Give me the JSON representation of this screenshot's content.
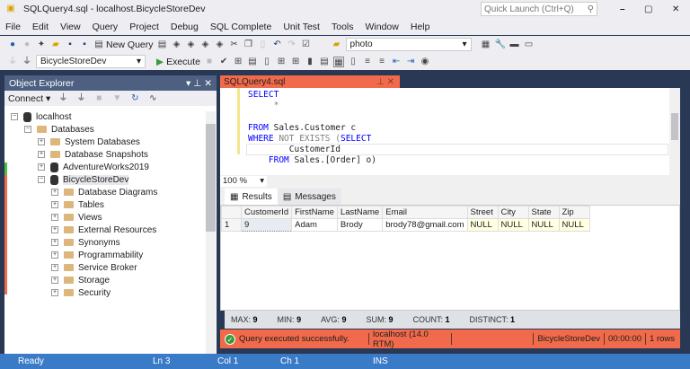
{
  "window": {
    "title": "SQLQuery4.sql - localhost.BicycleStoreDev",
    "quick_launch_placeholder": "Quick Launch (Ctrl+Q)"
  },
  "menu": [
    "File",
    "Edit",
    "View",
    "Query",
    "Project",
    "Debug",
    "SQL Complete",
    "Unit Test",
    "Tools",
    "Window",
    "Help"
  ],
  "toolbar": {
    "new_query": "New Query",
    "search_combo": "photo",
    "database": "BicycleStoreDev",
    "execute": "Execute"
  },
  "object_explorer": {
    "title": "Object Explorer",
    "connect": "Connect",
    "tree": [
      {
        "label": "localhost",
        "level": 0,
        "exp": "−",
        "icon": "server"
      },
      {
        "label": "Databases",
        "level": 1,
        "exp": "−",
        "icon": "folder"
      },
      {
        "label": "System Databases",
        "level": 2,
        "exp": "+",
        "icon": "folder"
      },
      {
        "label": "Database Snapshots",
        "level": 2,
        "exp": "+",
        "icon": "folder"
      },
      {
        "label": "AdventureWorks2019",
        "level": 2,
        "exp": "+",
        "icon": "db"
      },
      {
        "label": "BicycleStoreDev",
        "level": 2,
        "exp": "−",
        "icon": "db"
      },
      {
        "label": "Database Diagrams",
        "level": 3,
        "exp": "+",
        "icon": "folder"
      },
      {
        "label": "Tables",
        "level": 3,
        "exp": "+",
        "icon": "folder"
      },
      {
        "label": "Views",
        "level": 3,
        "exp": "+",
        "icon": "folder"
      },
      {
        "label": "External Resources",
        "level": 3,
        "exp": "+",
        "icon": "folder"
      },
      {
        "label": "Synonyms",
        "level": 3,
        "exp": "+",
        "icon": "folder"
      },
      {
        "label": "Programmability",
        "level": 3,
        "exp": "+",
        "icon": "folder"
      },
      {
        "label": "Service Broker",
        "level": 3,
        "exp": "+",
        "icon": "folder"
      },
      {
        "label": "Storage",
        "level": 3,
        "exp": "+",
        "icon": "folder"
      },
      {
        "label": "Security",
        "level": 3,
        "exp": "+",
        "icon": "folder"
      }
    ]
  },
  "editor": {
    "tab": "SQLQuery4.sql",
    "zoom": "100 %",
    "lines": [
      [
        {
          "t": "SELECT",
          "c": "kw"
        }
      ],
      [
        {
          "t": "     *",
          "c": "gr"
        }
      ],
      [],
      [
        {
          "t": "FROM",
          "c": "kw"
        },
        {
          "t": " Sales.Customer c",
          "c": ""
        }
      ],
      [
        {
          "t": "WHERE",
          "c": "kw"
        },
        {
          "t": " NOT EXISTS (",
          "c": "gr"
        },
        {
          "t": "SELECT",
          "c": "kw"
        }
      ],
      [
        {
          "t": "        CustomerId",
          "c": ""
        }
      ],
      [
        {
          "t": "    FROM",
          "c": "kw"
        },
        {
          "t": " Sales.[Order] o)",
          "c": ""
        }
      ]
    ]
  },
  "results": {
    "tabs": [
      "Results",
      "Messages"
    ],
    "columns": [
      "",
      "CustomerId",
      "FirstName",
      "LastName",
      "Email",
      "Street",
      "City",
      "State",
      "Zip"
    ],
    "rows": [
      [
        "1",
        "9",
        "Adam",
        "Brody",
        "brody78@gmail.com",
        "NULL",
        "NULL",
        "NULL",
        "NULL"
      ]
    ]
  },
  "aggregates": [
    {
      "k": "MAX:",
      "v": "9"
    },
    {
      "k": "MIN:",
      "v": "9"
    },
    {
      "k": "AVG:",
      "v": "9"
    },
    {
      "k": "SUM:",
      "v": "9"
    },
    {
      "k": "COUNT:",
      "v": "1"
    },
    {
      "k": "DISTINCT:",
      "v": "1"
    }
  ],
  "query_status": {
    "message": "Query executed successfully.",
    "server": "localhost (14.0 RTM)",
    "database": "BicycleStoreDev",
    "time": "00:00:00",
    "rows": "1 rows"
  },
  "statusbar": {
    "ready": "Ready",
    "ln": "Ln 3",
    "col": "Col 1",
    "ch": "Ch 1",
    "mode": "INS"
  },
  "colors": {
    "accent": "#f06a4b",
    "status_blue": "#3a7bc8",
    "frame": "#293955"
  }
}
